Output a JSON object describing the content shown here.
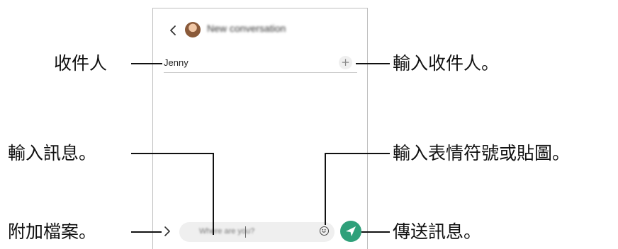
{
  "header": {
    "title": "New conversation"
  },
  "recipient": {
    "value": "Jenny",
    "add_icon": "+"
  },
  "composer": {
    "placeholder": "Where are you?"
  },
  "callouts": {
    "recipient": "收件人",
    "enter_recipient": "輸入收件人。",
    "enter_message": "輸入訊息。",
    "enter_emoji": "輸入表情符號或貼圖。",
    "attach": "附加檔案。",
    "send": "傳送訊息。"
  }
}
